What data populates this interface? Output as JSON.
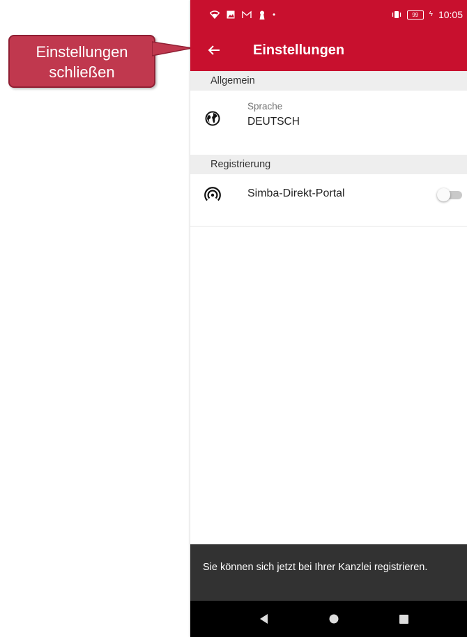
{
  "callout": {
    "line1": "Einstellungen",
    "line2": "schließen",
    "color": "#c0384e"
  },
  "statusbar": {
    "time": "10:05",
    "battery": "99"
  },
  "appbar": {
    "title": "Einstellungen",
    "color": "#c8102e"
  },
  "sections": {
    "general": {
      "header": "Allgemein",
      "language_label": "Sprache",
      "language_value": "DEUTSCH"
    },
    "registration": {
      "header": "Registrierung",
      "portal_label": "Simba-Direkt-Portal",
      "portal_enabled": false
    }
  },
  "snackbar": {
    "message": "Sie können sich jetzt bei Ihrer Kanzlei registrieren."
  },
  "icons": [
    "wifi-icon",
    "image-icon",
    "gmail-icon",
    "keyhole-icon",
    "vibrate-icon",
    "battery-icon",
    "back-arrow-icon",
    "globe-icon",
    "portal-signal-icon",
    "nav-back-icon",
    "nav-home-icon",
    "nav-recents-icon"
  ]
}
